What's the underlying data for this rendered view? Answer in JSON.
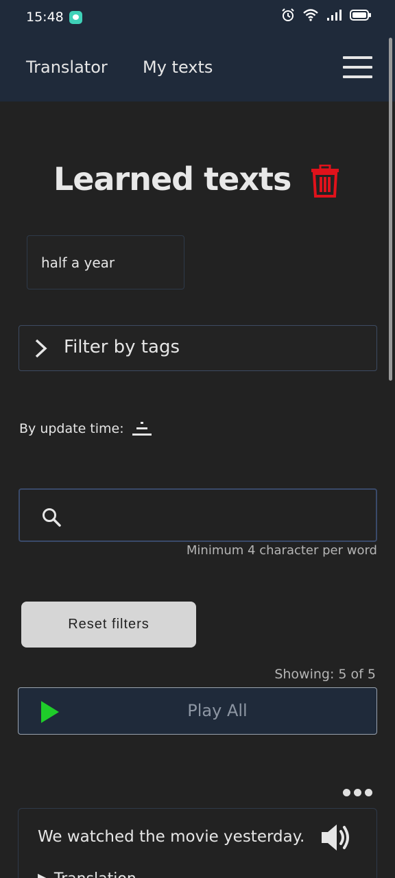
{
  "status_bar": {
    "time": "15:48",
    "icons": [
      "notification-chat-icon",
      "alarm-icon",
      "wifi-icon",
      "signal-icon",
      "battery-icon"
    ]
  },
  "header": {
    "nav": [
      {
        "label": "Translator"
      },
      {
        "label": "My texts"
      }
    ],
    "menu_icon": "hamburger-menu-icon"
  },
  "page": {
    "title": "Learned texts",
    "delete_icon": "trash-icon",
    "delete_color": "#e0121b"
  },
  "tag_chip": {
    "label": "half a year"
  },
  "filter_tags": {
    "label": "Filter by tags",
    "icon": "chevron-right-icon"
  },
  "sort": {
    "label": "By update time:",
    "icon": "sort-icon"
  },
  "search": {
    "placeholder": "",
    "value": "",
    "hint": "Minimum 4 character per word"
  },
  "reset": {
    "label": "Reset filters"
  },
  "showing": {
    "text": "Showing: 5 of 5"
  },
  "play_all": {
    "label": "Play All",
    "icon": "play-icon",
    "icon_color": "#1fcc2a"
  },
  "texts": [
    {
      "sentence": "We watched the movie yesterday.",
      "translation_label": "Translation"
    }
  ],
  "colors": {
    "header_bg": "#1f2a3a",
    "page_bg": "#222222",
    "accent_green": "#1fcc2a",
    "danger_red": "#e0121b"
  }
}
